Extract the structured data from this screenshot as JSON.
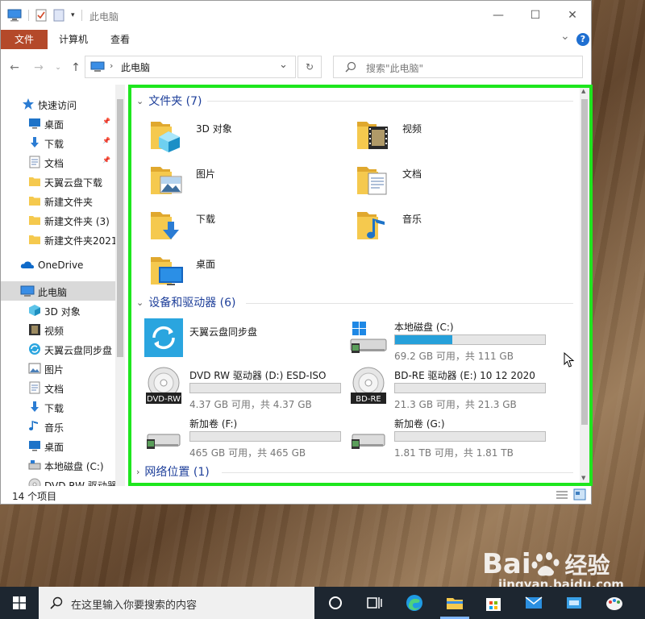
{
  "window": {
    "title": "此电脑",
    "controls": {
      "minimize": "—",
      "maximize": "☐",
      "close": "✕"
    }
  },
  "ribbon": {
    "tabs": [
      "文件",
      "计算机",
      "查看"
    ],
    "expand_glyph": "⌄",
    "help_glyph": "?"
  },
  "nav": {
    "address": "此电脑",
    "search_placeholder": "搜索\"此电脑\""
  },
  "sidebar": {
    "items": [
      {
        "label": "快速访问",
        "icon": "star-icon"
      },
      {
        "label": "桌面",
        "icon": "desktop-icon",
        "pinned": true
      },
      {
        "label": "下载",
        "icon": "download-icon",
        "pinned": true
      },
      {
        "label": "文档",
        "icon": "document-icon",
        "pinned": true
      },
      {
        "label": "天翼云盘下载",
        "icon": "folder-icon"
      },
      {
        "label": "新建文件夹",
        "icon": "folder-icon"
      },
      {
        "label": "新建文件夹 (3)",
        "icon": "folder-icon"
      },
      {
        "label": "新建文件夹2021",
        "icon": "folder-icon"
      },
      {
        "label": "OneDrive",
        "icon": "cloud-icon"
      },
      {
        "label": "此电脑",
        "icon": "computer-icon",
        "selected": true
      },
      {
        "label": "3D 对象",
        "icon": "cube-icon"
      },
      {
        "label": "视频",
        "icon": "film-icon"
      },
      {
        "label": "天翼云盘同步盘",
        "icon": "sync-icon"
      },
      {
        "label": "图片",
        "icon": "picture-icon"
      },
      {
        "label": "文档",
        "icon": "document-icon"
      },
      {
        "label": "下载",
        "icon": "download-icon"
      },
      {
        "label": "音乐",
        "icon": "music-icon"
      },
      {
        "label": "桌面",
        "icon": "desktop-icon"
      },
      {
        "label": "本地磁盘 (C:)",
        "icon": "drive-icon"
      },
      {
        "label": "DVD RW 驱动器",
        "icon": "disc-icon"
      }
    ]
  },
  "main": {
    "folders_header": "文件夹 (7)",
    "folders": [
      {
        "label": "3D 对象",
        "icon": "cube-icon"
      },
      {
        "label": "视频",
        "icon": "film-icon"
      },
      {
        "label": "图片",
        "icon": "picture-icon"
      },
      {
        "label": "文档",
        "icon": "document-icon"
      },
      {
        "label": "下载",
        "icon": "download-icon"
      },
      {
        "label": "音乐",
        "icon": "music-icon"
      },
      {
        "label": "桌面",
        "icon": "desktop-icon"
      }
    ],
    "drives_header": "设备和驱动器 (6)",
    "drives": [
      {
        "label": "天翼云盘同步盘",
        "icon": "sync-icon",
        "has_bar": false
      },
      {
        "label": "本地磁盘 (C:)",
        "icon": "windows-drive-icon",
        "has_bar": true,
        "used_fraction": 0.38,
        "space": "69.2 GB 可用，共 111 GB"
      },
      {
        "label": "DVD RW 驱动器 (D:) ESD-ISO",
        "icon": "dvd-rw-icon",
        "badge": "DVD-RW",
        "has_bar": true,
        "used_fraction": 0,
        "space": "4.37 GB 可用，共 4.37 GB"
      },
      {
        "label": "BD-RE 驱动器 (E:) 10 12 2020",
        "icon": "bd-re-icon",
        "badge": "BD-RE",
        "has_bar": true,
        "used_fraction": 0,
        "space": "21.3 GB 可用，共 21.3 GB"
      },
      {
        "label": "新加卷 (F:)",
        "icon": "drive-icon",
        "has_bar": true,
        "used_fraction": 0,
        "space": "465 GB 可用，共 465 GB"
      },
      {
        "label": "新加卷 (G:)",
        "icon": "drive-icon",
        "has_bar": true,
        "used_fraction": 0,
        "space": "1.81 TB 可用，共 1.81 TB"
      }
    ],
    "network_header": "网络位置 (1)"
  },
  "status": {
    "items": "14 个项目"
  },
  "taskbar": {
    "search_placeholder": "在这里输入你要搜索的内容"
  },
  "watermark": {
    "brand": "Bai",
    "brand2": "经验",
    "url": "jingyan.baidu.com"
  },
  "colors": {
    "highlight": "#1ee61e",
    "file_tab": "#b4492a",
    "header_blue": "#1e3f9a",
    "bar_fill": "#26a0da",
    "folder": "#f5c94e"
  }
}
